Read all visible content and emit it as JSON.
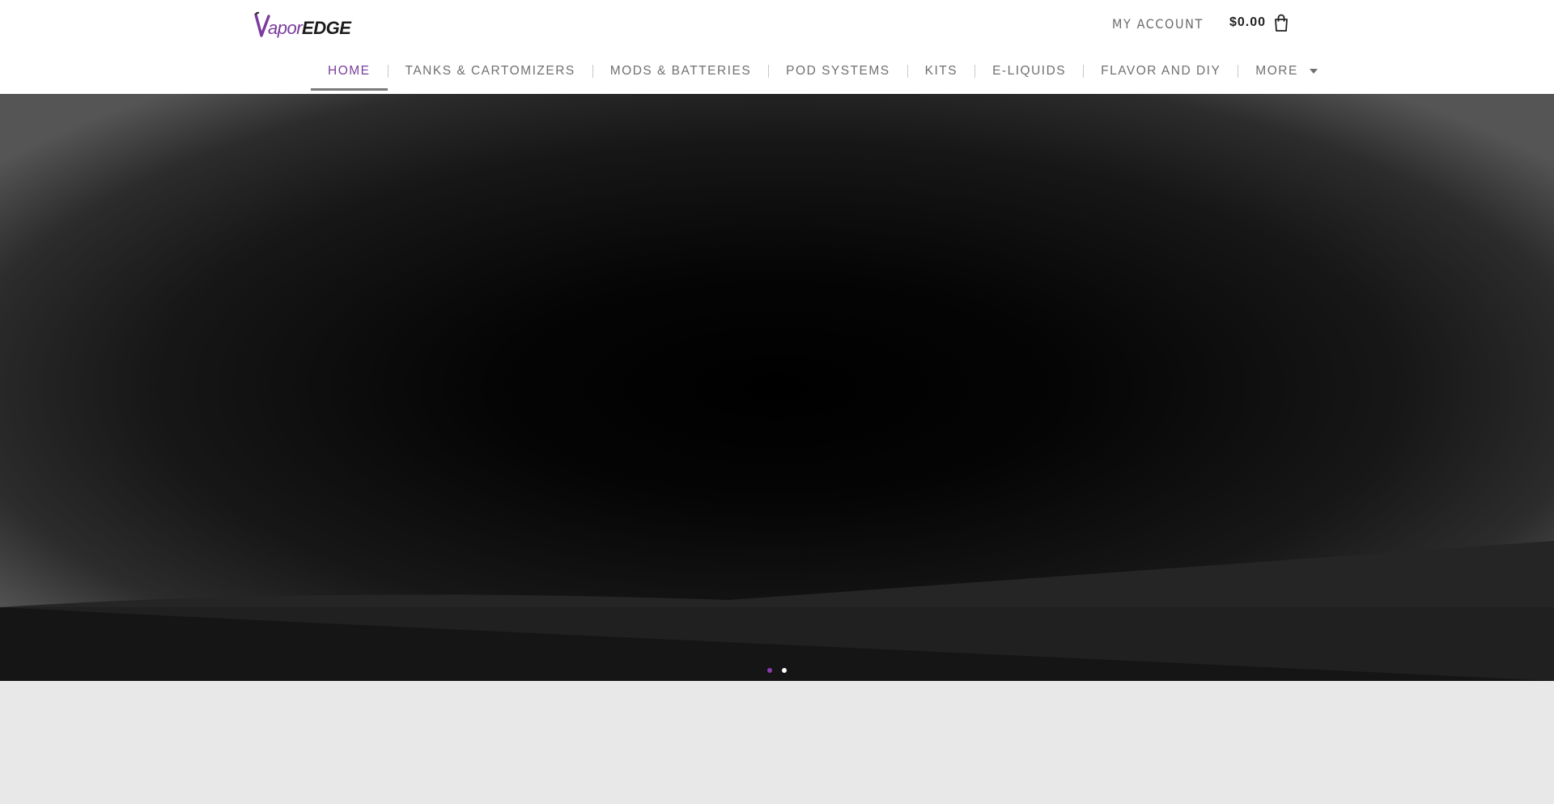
{
  "brand": {
    "logo_text_vapor": "apor",
    "logo_text_edge": "EDGE",
    "logo_alt": "VaporEDGE",
    "purple": "#7a3b9e",
    "dark": "#1b1b1b"
  },
  "header": {
    "account_label": "MY ACCOUNT",
    "cart_total": "$0.00",
    "cart_icon": "shopping-bag-icon"
  },
  "nav": {
    "items": [
      {
        "label": "HOME",
        "active": true
      },
      {
        "label": "TANKS & CARTOMIZERS"
      },
      {
        "label": "MODS & BATTERIES"
      },
      {
        "label": "POD SYSTEMS"
      },
      {
        "label": "KITS"
      },
      {
        "label": "E-LIQUIDS"
      },
      {
        "label": "FLAVOR AND DIY"
      },
      {
        "label": "MORE",
        "has_dropdown": true
      }
    ],
    "active_color": "#7b3f9b",
    "text_color": "#707070"
  },
  "slider": {
    "slide_count": 2,
    "active_slide": 1,
    "dot_active_color": "#8e3bb0",
    "dot_color": "#ffffff"
  }
}
